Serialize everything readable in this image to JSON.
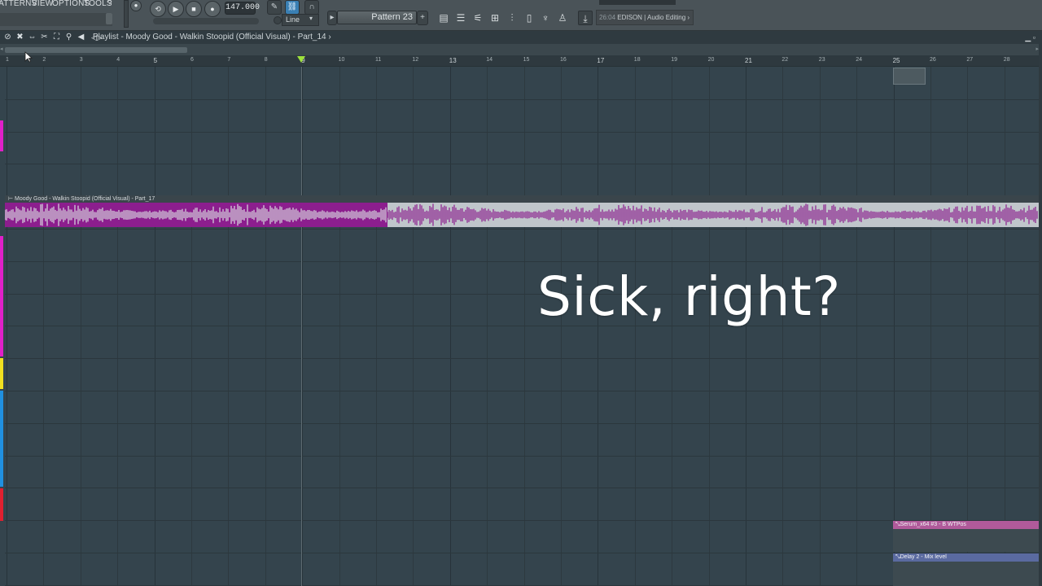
{
  "menu": {
    "items": [
      "PATTERNS",
      "VIEW",
      "OPTIONS",
      "TOOLS",
      "?"
    ]
  },
  "transport": {
    "tempo": "147.000",
    "pattern": "Pattern 23",
    "snap": "Line"
  },
  "hint_bar": {
    "number": "26:04",
    "text": "EDISON | Audio Editing"
  },
  "playlist": {
    "title": "Playlist - Moody Good - Walkin Stoopid (Official Visual) - Part_14"
  },
  "ruler": {
    "bars": [
      "1",
      "2",
      "3",
      "4",
      "5",
      "6",
      "7",
      "8",
      "9",
      "10",
      "11",
      "12",
      "13",
      "14",
      "15",
      "16",
      "17",
      "18",
      "19",
      "20",
      "21",
      "22",
      "23",
      "24",
      "25",
      "26",
      "27",
      "28"
    ]
  },
  "clip": {
    "name": "Moody Good - Walkin Stoopid (Official Visual) - Part_17",
    "played_fraction": 0.37,
    "played_color": "#8c1e8e",
    "unplayed_color": "#c0c6cb"
  },
  "automation": [
    {
      "name": "Serum_x64 #3 - B WTPos",
      "color": "#b05a9a"
    },
    {
      "name": "Delay 2 - Mix level",
      "color": "#5a6aa0"
    }
  ],
  "track_colors": [
    "#e020c8",
    "#e020c8",
    "#f0e020",
    "#2090e0",
    "#e02030"
  ],
  "caption": {
    "text": "Sick, right?"
  }
}
